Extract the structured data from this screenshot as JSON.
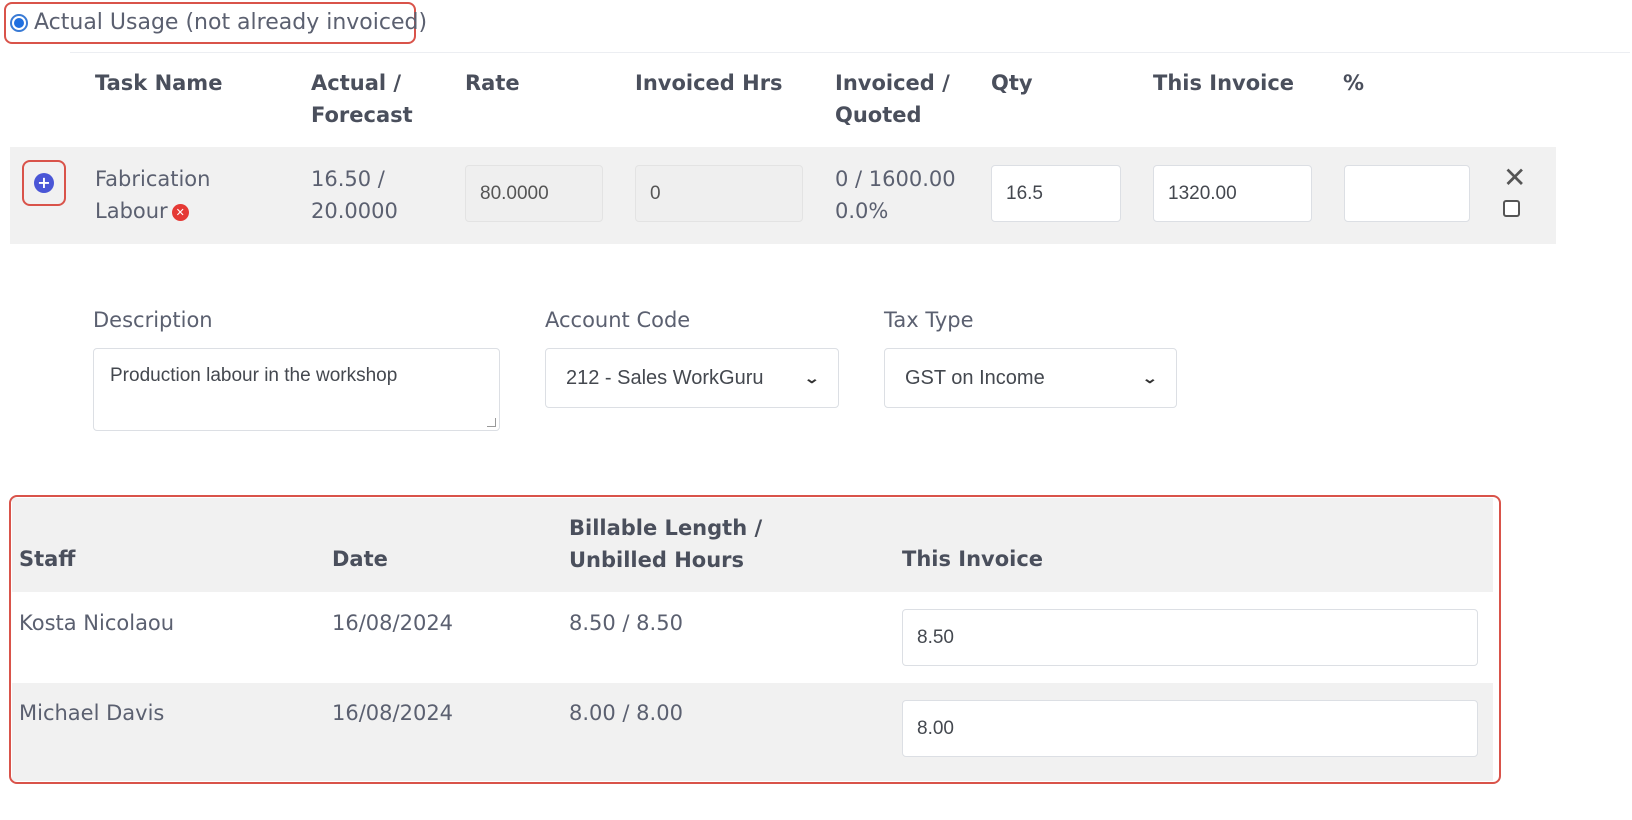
{
  "radio": {
    "label": "Actual Usage (not already invoiced)",
    "selected": true
  },
  "task_table": {
    "headers": {
      "task_name": "Task Name",
      "actual_forecast_1": "Actual /",
      "actual_forecast_2": "Forecast",
      "rate": "Rate",
      "invoiced_hrs": "Invoiced Hrs",
      "invoiced_quoted_1": "Invoiced /",
      "invoiced_quoted_2": "Quoted",
      "qty": "Qty",
      "this_invoice": "This Invoice",
      "percent": "%"
    },
    "row": {
      "task_name_1": "Fabrication",
      "task_name_2": "Labour",
      "actual_forecast_1": "16.50 /",
      "actual_forecast_2": "20.0000",
      "rate": "80.0000",
      "invoiced_hrs": "0",
      "invoiced_quoted_1": "0 / 1600.00",
      "invoiced_quoted_2": "0.0%",
      "qty": "16.5",
      "this_invoice": "1320.00",
      "percent": ""
    }
  },
  "details": {
    "description_label": "Description",
    "description_value": "Production labour in the workshop",
    "account_code_label": "Account Code",
    "account_code_value": "212 - Sales WorkGuru",
    "tax_type_label": "Tax Type",
    "tax_type_value": "GST on Income"
  },
  "staff_table": {
    "headers": {
      "staff": "Staff",
      "date": "Date",
      "billable_1": "Billable Length /",
      "billable_2": "Unbilled Hours",
      "this_invoice": "This Invoice"
    },
    "rows": [
      {
        "staff": "Kosta Nicolaou",
        "date": "16/08/2024",
        "hours": "8.50 / 8.50",
        "this_invoice": "8.50"
      },
      {
        "staff": "Michael Davis",
        "date": "16/08/2024",
        "hours": "8.00 / 8.00",
        "this_invoice": "8.00"
      }
    ]
  },
  "colors": {
    "highlight_border": "#d9534a",
    "accent_blue": "#4a56d6",
    "row_bg": "#f1f1f1"
  }
}
